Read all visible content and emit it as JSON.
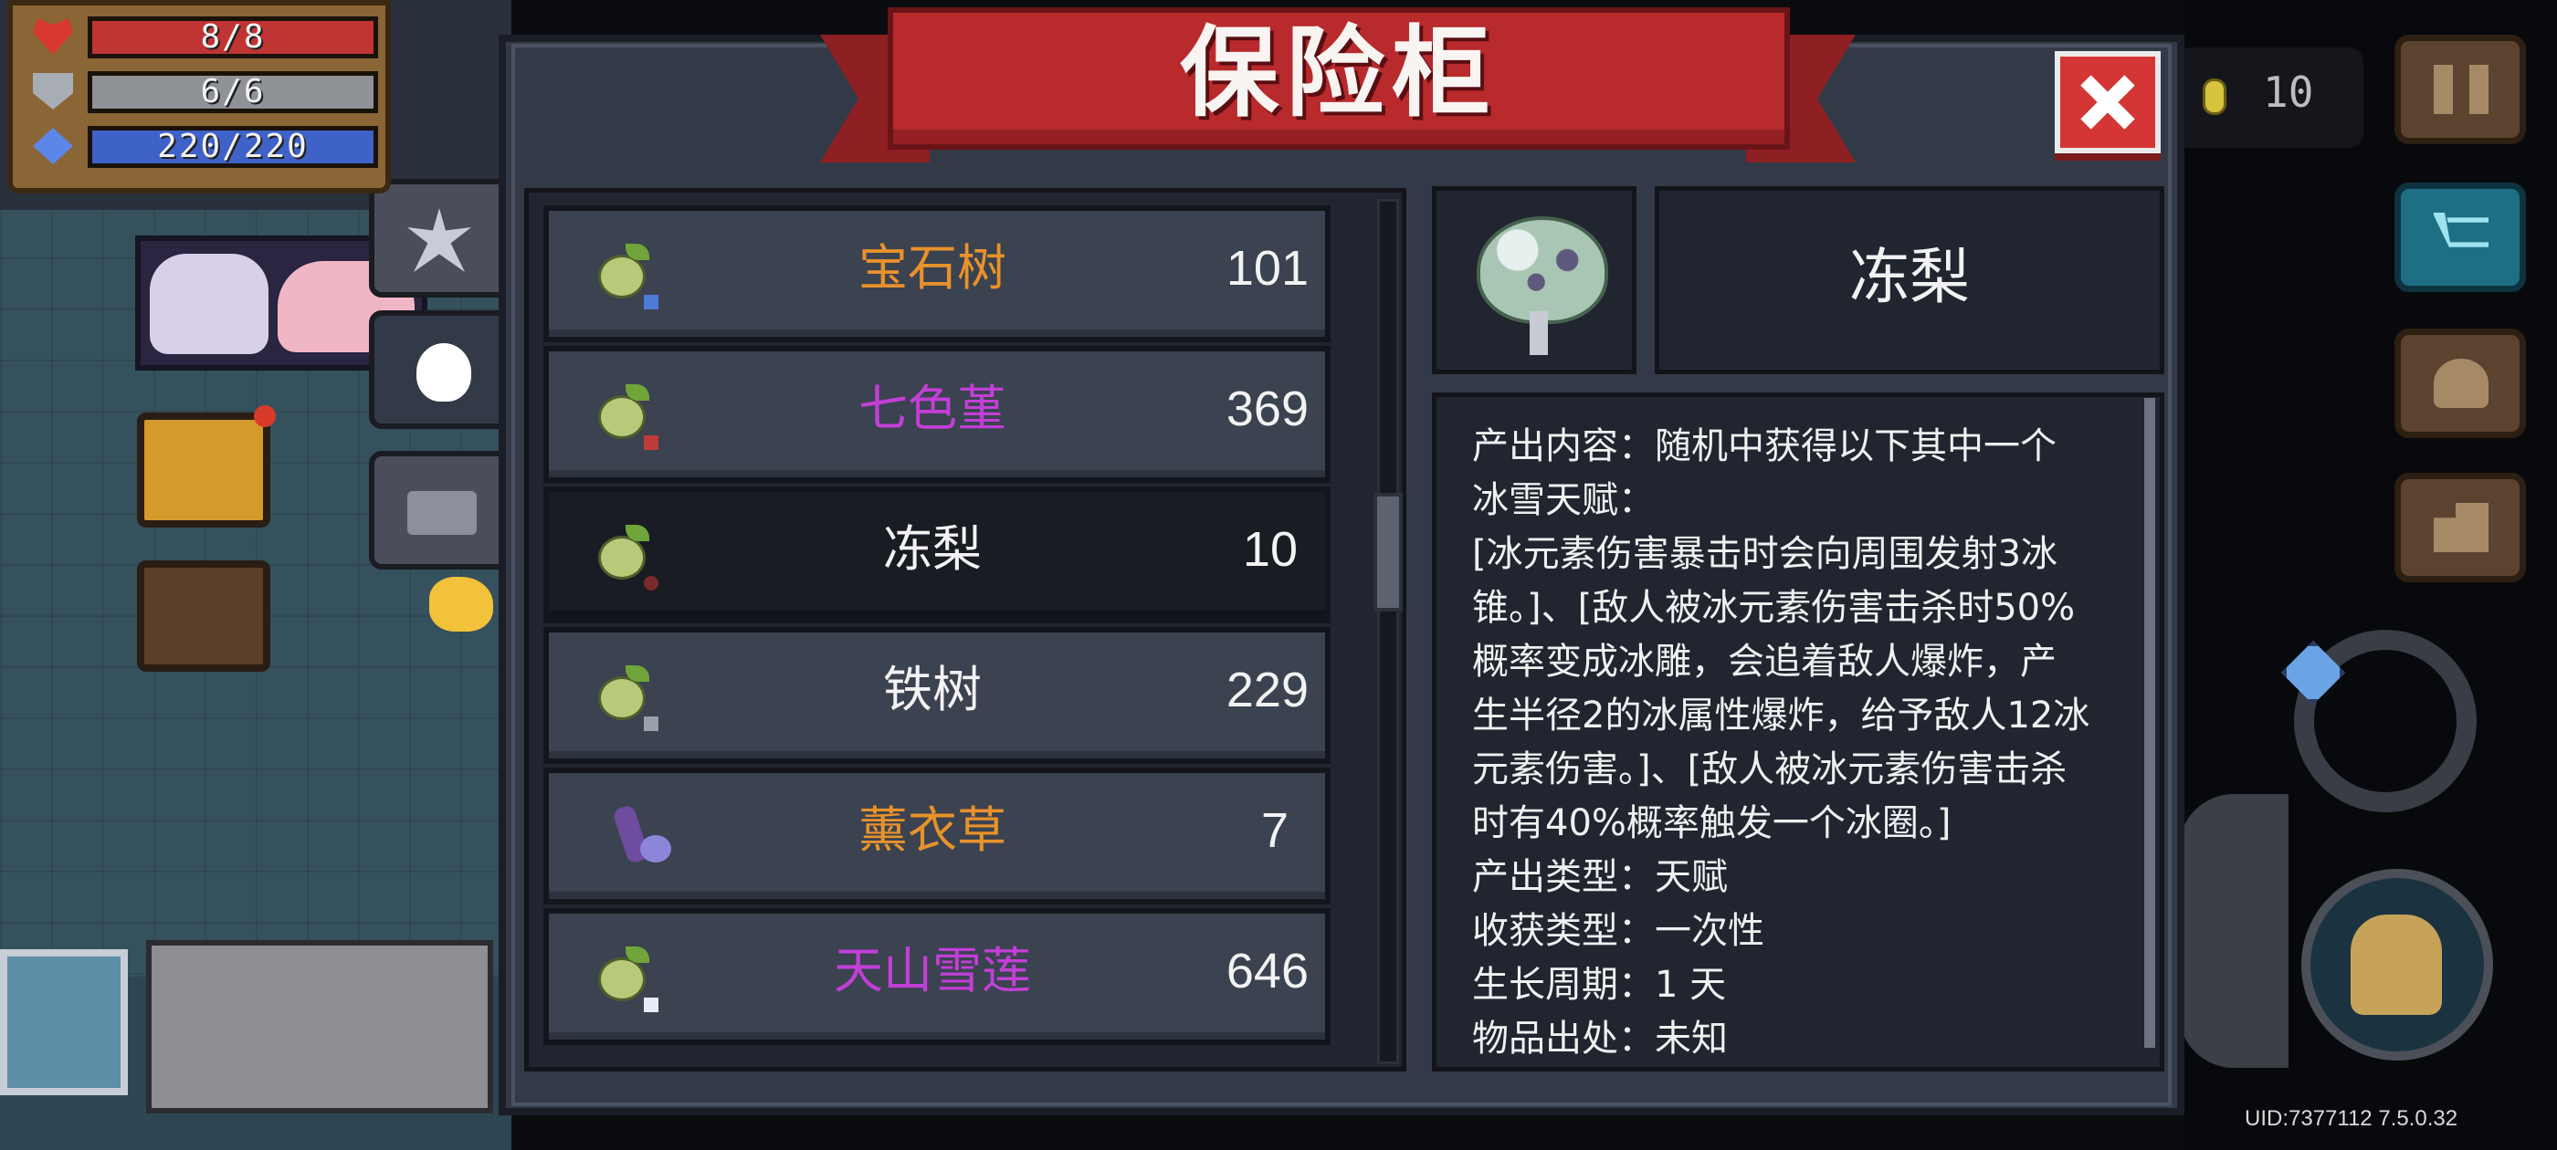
{
  "hud": {
    "health": "8/8",
    "shield": "6/6",
    "energy": "220/220",
    "coins": "10",
    "uid_version": "UID:7377112 7.5.0.32"
  },
  "modal": {
    "title": "保险柜",
    "close_icon": "close-x",
    "tabs": [
      "burst-icon",
      "plant-icon",
      "ticket-icon"
    ],
    "active_tab": 1
  },
  "plants": [
    {
      "name": "宝石树",
      "count": "101",
      "color": "#e8922b",
      "icon": "seed-icon"
    },
    {
      "name": "七色堇",
      "count": "369",
      "color": "#c23fd6",
      "icon": "seed-icon"
    },
    {
      "name": "冻梨",
      "count": "10",
      "color": "#f3f3f3",
      "icon": "seed-icon",
      "selected": true
    },
    {
      "name": "铁树",
      "count": "229",
      "color": "#f3f3f3",
      "icon": "seed-icon"
    },
    {
      "name": "薰衣草",
      "count": "7",
      "color": "#e8922b",
      "icon": "lavender-icon"
    },
    {
      "name": "天山雪莲",
      "count": "646",
      "color": "#c23fd6",
      "icon": "seed-icon"
    }
  ],
  "detail": {
    "name": "冻梨",
    "icon": "frozen-pear-tree-icon",
    "desc_lines": [
      "产出内容：随机中获得以下其中一个",
      "冰雪天赋：",
      "[冰元素伤害暴击时会向周围发射3冰",
      "锥。]、[敌人被冰元素伤害击杀时50%",
      "概率变成冰雕，会追着敌人爆炸，产",
      "生半径2的冰属性爆炸，给予敌人12冰",
      "元素伤害。]、[敌人被冰元素伤害击杀",
      "时有40%概率触发一个冰圈。]",
      "产出类型：天赋",
      "收获类型：一次性",
      "生长周期：1 天",
      "物品出处：未知"
    ]
  }
}
